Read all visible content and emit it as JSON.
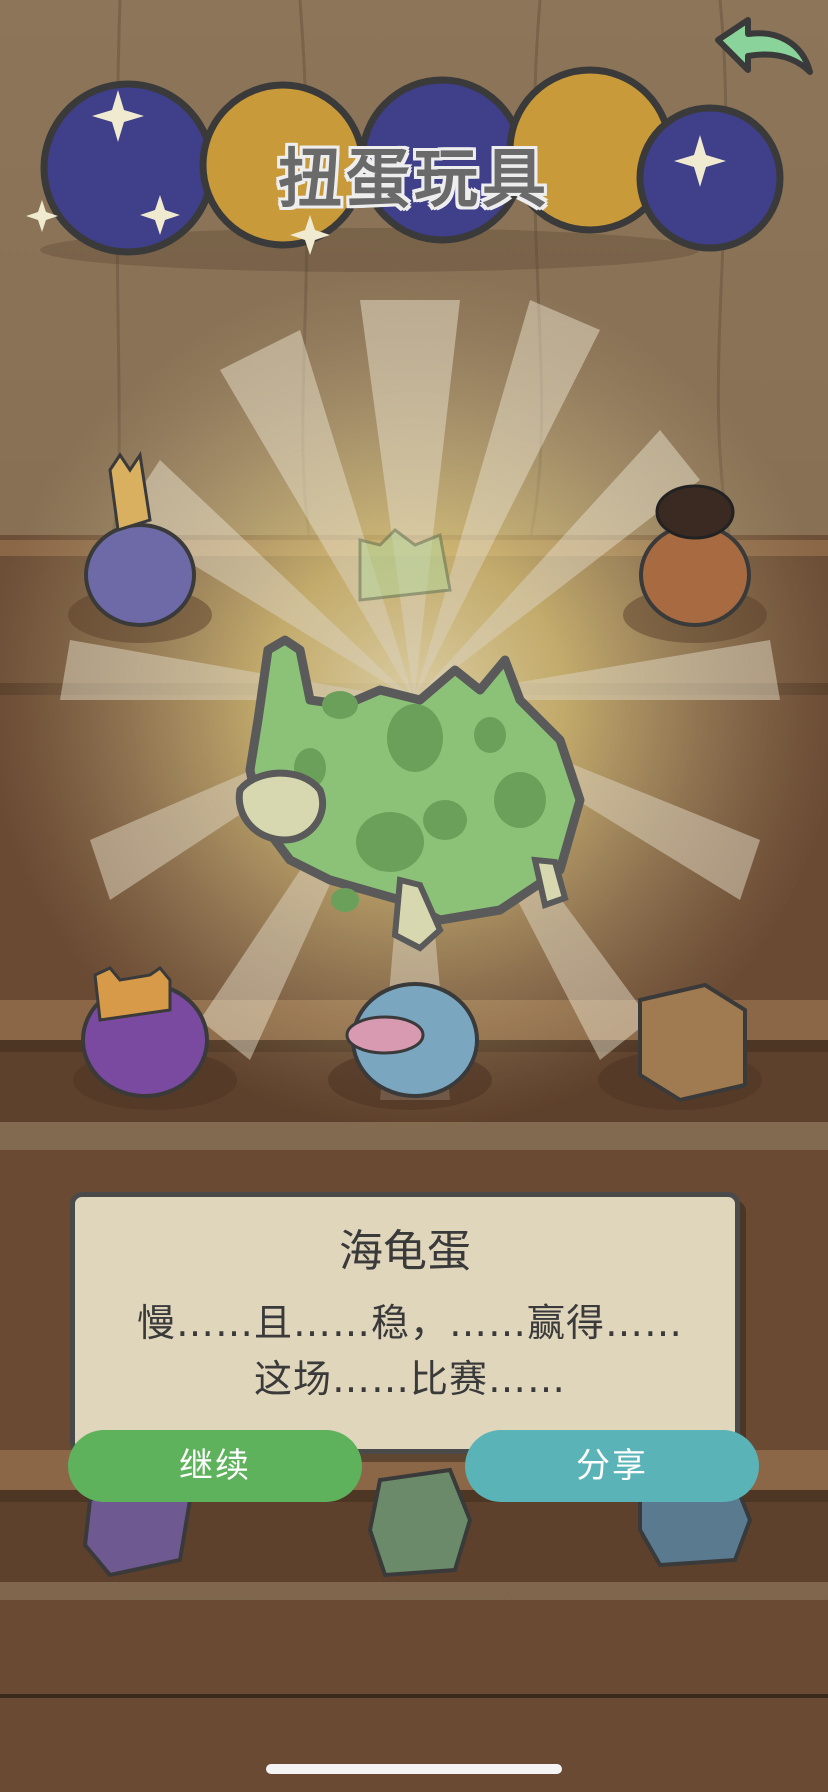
{
  "header": {
    "title": "扭蛋玩具",
    "back_icon": "back-arrow-icon"
  },
  "prize": {
    "name": "海龟蛋",
    "description": "慢……且……稳，……赢得……这场……比赛……"
  },
  "actions": {
    "continue_label": "继续",
    "share_label": "分享"
  },
  "colors": {
    "continue": "#5fb25c",
    "share": "#5ab3b6",
    "egg_green": "#8cc278",
    "wood": "#8a7258"
  },
  "shelf": {
    "items": [
      {
        "name": "giraffe-egg",
        "color": "#6e6aa8"
      },
      {
        "name": "green-egg-shell",
        "color": "#b6d49a"
      },
      {
        "name": "dog-egg",
        "color": "#a86a40"
      },
      {
        "name": "cat-egg",
        "color": "#7a4aa0"
      },
      {
        "name": "pig-egg",
        "color": "#7aa6c0"
      },
      {
        "name": "dice-box",
        "color": "#a07a50"
      }
    ]
  }
}
